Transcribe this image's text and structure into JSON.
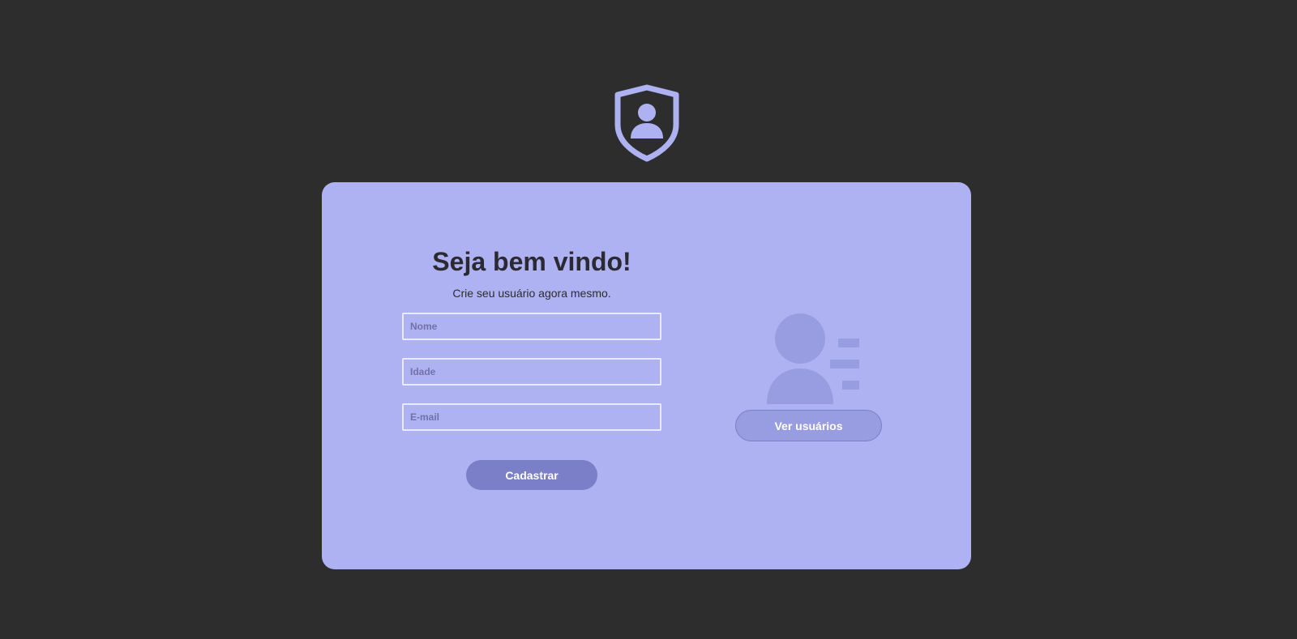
{
  "header": {
    "logo_icon": "shield-user-icon"
  },
  "form": {
    "title": "Seja bem vindo!",
    "subtitle": "Crie seu usuário agora mesmo.",
    "fields": [
      {
        "placeholder": "Nome",
        "value": ""
      },
      {
        "placeholder": "Idade",
        "value": ""
      },
      {
        "placeholder": "E-mail",
        "value": ""
      }
    ],
    "submit_label": "Cadastrar"
  },
  "side": {
    "illustration_icon": "user-list-icon",
    "users_button_label": "Ver usuários"
  },
  "colors": {
    "background": "#2d2d2d",
    "card": "#afb2f2",
    "accent": "#7b7fc7",
    "illustration": "#989ce0",
    "text": "#2b2a33"
  }
}
